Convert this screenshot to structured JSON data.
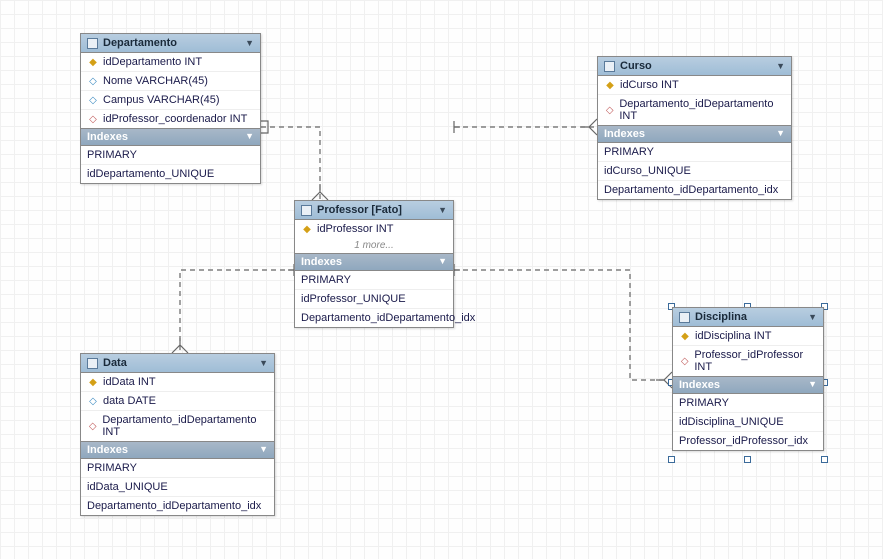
{
  "entities": {
    "departamento": {
      "title": "Departamento",
      "columns": [
        {
          "icon": "key",
          "text": "idDepartamento INT"
        },
        {
          "icon": "diamond-blue",
          "text": "Nome VARCHAR(45)"
        },
        {
          "icon": "diamond-blue",
          "text": "Campus VARCHAR(45)"
        },
        {
          "icon": "diamond-red",
          "text": "idProfessor_coordenador INT"
        }
      ],
      "indexesLabel": "Indexes",
      "indexes": [
        "PRIMARY",
        "idDepartamento_UNIQUE"
      ]
    },
    "curso": {
      "title": "Curso",
      "columns": [
        {
          "icon": "key",
          "text": "idCurso INT"
        },
        {
          "icon": "diamond-red",
          "text": "Departamento_idDepartamento INT"
        }
      ],
      "indexesLabel": "Indexes",
      "indexes": [
        "PRIMARY",
        "idCurso_UNIQUE",
        "Departamento_idDepartamento_idx"
      ]
    },
    "professor": {
      "title": "Professor [Fato]",
      "columns": [
        {
          "icon": "key",
          "text": "idProfessor INT"
        }
      ],
      "more": "1 more...",
      "indexesLabel": "Indexes",
      "indexes": [
        "PRIMARY",
        "idProfessor_UNIQUE",
        "Departamento_idDepartamento_idx"
      ]
    },
    "data": {
      "title": "Data",
      "columns": [
        {
          "icon": "key",
          "text": "idData INT"
        },
        {
          "icon": "diamond-blue",
          "text": "data DATE"
        },
        {
          "icon": "diamond-red",
          "text": "Departamento_idDepartamento INT"
        }
      ],
      "indexesLabel": "Indexes",
      "indexes": [
        "PRIMARY",
        "idData_UNIQUE",
        "Departamento_idDepartamento_idx"
      ]
    },
    "disciplina": {
      "title": "Disciplina",
      "columns": [
        {
          "icon": "key",
          "text": "idDisciplina INT"
        },
        {
          "icon": "diamond-red",
          "text": "Professor_idProfessor INT"
        }
      ],
      "indexesLabel": "Indexes",
      "indexes": [
        "PRIMARY",
        "idDisciplina_UNIQUE",
        "Professor_idProfessor_idx"
      ]
    }
  }
}
